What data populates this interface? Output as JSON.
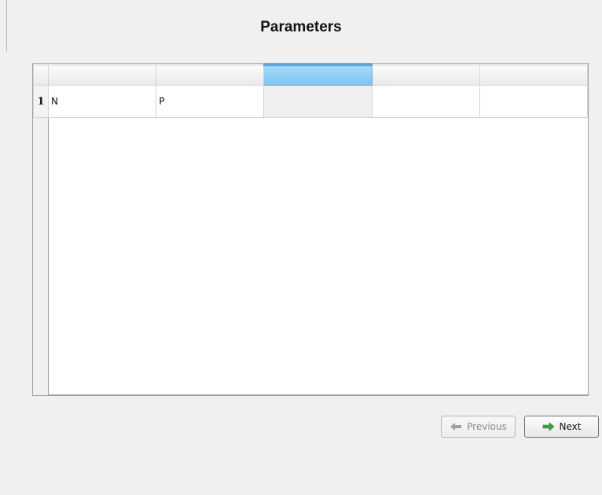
{
  "title": "Parameters",
  "table": {
    "selected_column": 3,
    "rows": [
      {
        "row_number": "1",
        "cells": [
          "N",
          "P",
          "",
          "",
          ""
        ]
      }
    ]
  },
  "buttons": {
    "previous_label": "Previous",
    "next_label": "Next",
    "previous_icon": "arrow-left-icon",
    "next_icon": "arrow-right-icon"
  },
  "colors": {
    "selected_header": "#7cc3f2",
    "next_arrow": "#3aa63a",
    "previous_arrow": "#a0a0a0"
  }
}
